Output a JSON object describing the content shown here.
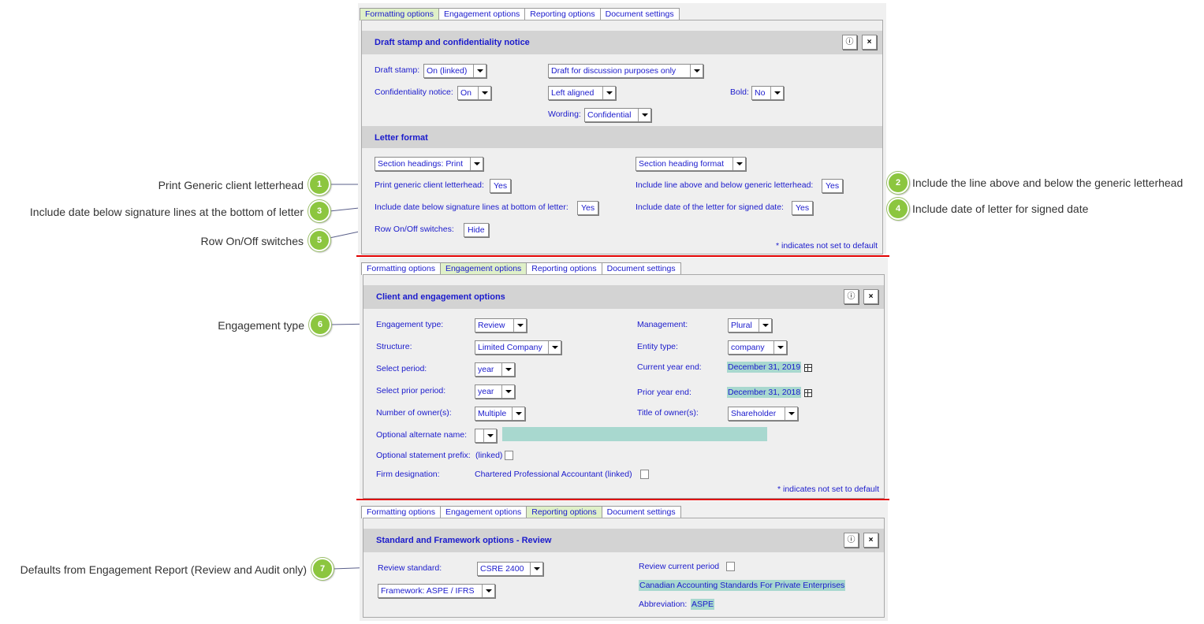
{
  "tabs": [
    "Formatting options",
    "Engagement options",
    "Reporting options",
    "Document settings"
  ],
  "common": {
    "info_icon": "info-icon",
    "close_icon": "close-icon",
    "not_default_note": "* indicates not set to default"
  },
  "panel1": {
    "header1": "Draft stamp and confidentiality notice",
    "draft_stamp_label": "Draft stamp:",
    "draft_stamp_value": "On (linked)",
    "draft_text_value": "Draft for discussion purposes only",
    "conf_notice_label": "Confidentiality notice:",
    "conf_notice_value": "On",
    "alignment_value": "Left aligned",
    "bold_label": "Bold:",
    "bold_value": "No",
    "wording_label": "Wording:",
    "wording_value": "Confidential",
    "header2": "Letter format",
    "section_headings_value": "Section headings: Print",
    "section_heading_format_value": "Section heading format",
    "print_letterhead_label": "Print generic client letterhead:",
    "print_letterhead_value": "Yes",
    "line_letterhead_label": "Include line above and below generic letterhead:",
    "line_letterhead_value": "Yes",
    "date_below_sig_label": "Include date below signature lines at bottom of letter:",
    "date_below_sig_value": "Yes",
    "date_signed_label": "Include date of the letter for signed date:",
    "date_signed_value": "Yes",
    "row_switches_label": "Row On/Off switches:",
    "row_switches_value": "Hide"
  },
  "panel2": {
    "header": "Client and engagement options",
    "engagement_type_label": "Engagement type:",
    "engagement_type_value": "Review",
    "management_label": "Management:",
    "management_value": "Plural",
    "structure_label": "Structure:",
    "structure_value": "Limited Company",
    "entity_type_label": "Entity type:",
    "entity_type_value": "company",
    "select_period_label": "Select period:",
    "select_period_value": "year",
    "current_year_end_label": "Current year end:",
    "current_year_end_value": "December 31, 2019",
    "select_prior_period_label": "Select prior period:",
    "select_prior_period_value": "year",
    "prior_year_end_label": "Prior year end:",
    "prior_year_end_value": "December 31, 2018",
    "owners_label": "Number of owner(s):",
    "owners_value": "Multiple",
    "owner_title_label": "Title of owner(s):",
    "owner_title_value": "Shareholder",
    "alt_name_label": "Optional alternate name:",
    "stmt_prefix_label": "Optional statement prefix:",
    "stmt_prefix_value": "(linked)",
    "firm_label": "Firm designation:",
    "firm_value": "Chartered Professional Accountant (linked)"
  },
  "panel3": {
    "header": "Standard and Framework options - Review",
    "review_std_label": "Review standard:",
    "review_std_value": "CSRE 2400",
    "review_period_value": "Review current period",
    "framework_value": "Framework: ASPE / IFRS",
    "framework_name": "Canadian Accounting Standards For Private Enterprises",
    "abbrev_label": "Abbreviation:",
    "abbrev_value": "ASPE"
  },
  "callouts": [
    {
      "num": "1",
      "text": "Print Generic client letterhead"
    },
    {
      "num": "2",
      "text": "Include the line above and below the generic letterhead"
    },
    {
      "num": "3",
      "text": "Include date below signature lines at the bottom of letter"
    },
    {
      "num": "4",
      "text": "Include date of letter for signed date"
    },
    {
      "num": "5",
      "text": "Row On/Off switches"
    },
    {
      "num": "6",
      "text": "Engagement type"
    },
    {
      "num": "7",
      "text": "Defaults from Engagement Report (Review and Audit only)"
    }
  ]
}
